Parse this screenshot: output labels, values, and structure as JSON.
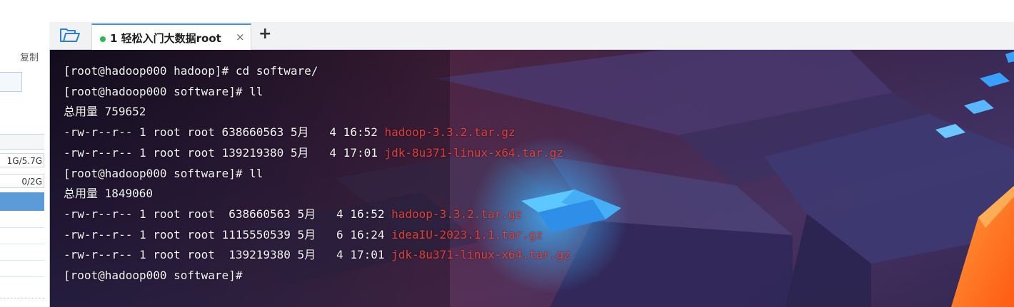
{
  "left_panel": {
    "copy_label": "复制",
    "mem_used": "1G/5.7G",
    "swap_used": "0/2G"
  },
  "tabbar": {
    "folder_icon": "folder-open-icon",
    "tab": {
      "title": "1 轻松入门大数据root",
      "close": "×",
      "status_color": "#2db84d"
    },
    "add_tab": "+"
  },
  "terminal": {
    "lines": [
      {
        "text": "[root@hadoop000 hadoop]# cd software/",
        "file": ""
      },
      {
        "text": "[root@hadoop000 software]# ll",
        "file": ""
      },
      {
        "text": "总用量 759652",
        "file": ""
      },
      {
        "text": "-rw-r--r-- 1 root root 638660563 5月   4 16:52 ",
        "file": "hadoop-3.3.2.tar.gz"
      },
      {
        "text": "-rw-r--r-- 1 root root 139219380 5月   4 17:01 ",
        "file": "jdk-8u371-linux-x64.tar.gz"
      },
      {
        "text": "[root@hadoop000 software]# ll",
        "file": ""
      },
      {
        "text": "总用量 1849060",
        "file": ""
      },
      {
        "text": "-rw-r--r-- 1 root root  638660563 5月   4 16:52 ",
        "file": "hadoop-3.3.2.tar.gz"
      },
      {
        "text": "-rw-r--r-- 1 root root 1115550539 5月   6 16:24 ",
        "file": "ideaIU-2023.1.1.tar.gz"
      },
      {
        "text": "-rw-r--r-- 1 root root  139219380 5月   4 17:01 ",
        "file": "jdk-8u371-linux-x64.tar.gz"
      },
      {
        "text": "[root@hadoop000 software]# ",
        "file": ""
      }
    ],
    "text_color": "#f4f4f4",
    "file_color": "#e0403a"
  }
}
